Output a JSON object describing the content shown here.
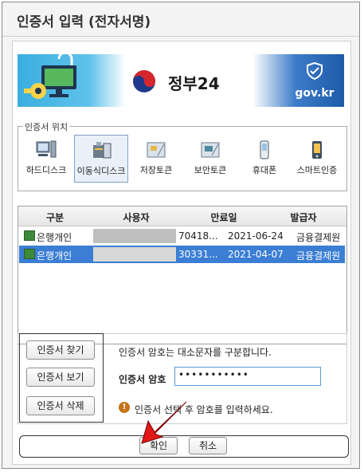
{
  "title": "인증서 입력 (전자서명)",
  "banner": {
    "logo_text": "정부24",
    "right_text": "gov.kr",
    "left_icon": "key-monitor-icon",
    "shield_icon": "shield-check-icon"
  },
  "location": {
    "label": "인증서 위치",
    "items": [
      {
        "label": "하드디스크",
        "icon": "computer-icon",
        "selected": false
      },
      {
        "label": "이동식디스크",
        "icon": "usb-drive-icon",
        "selected": true
      },
      {
        "label": "저장토큰",
        "icon": "storage-token-icon",
        "selected": false
      },
      {
        "label": "보안토큰",
        "icon": "security-token-icon",
        "selected": false
      },
      {
        "label": "휴대폰",
        "icon": "mobile-phone-icon",
        "selected": false
      },
      {
        "label": "스마트인증",
        "icon": "smart-cert-icon",
        "selected": false
      }
    ]
  },
  "table": {
    "headers": [
      "구분",
      "사용자",
      "만료일",
      "발급자"
    ],
    "rows": [
      {
        "type": "은행개인",
        "user": "70418...",
        "expiry": "2021-06-24",
        "issuer": "금융결제원",
        "selected": false
      },
      {
        "type": "은행개인",
        "user": "30331...",
        "expiry": "2021-04-07",
        "issuer": "금융결제원",
        "selected": true
      }
    ]
  },
  "buttons": {
    "find": "인증서 찾기",
    "view": "인증서 보기",
    "delete": "인증서 삭제",
    "ok": "확인",
    "cancel": "취소"
  },
  "password": {
    "note": "인증서 암호는 대소문자를 구분합니다.",
    "label": "인증서 암호",
    "value": "•••••••••••",
    "hint": "인증서 선택 후 암호를 입력하세요."
  },
  "colors": {
    "selected_row": "#3b7ed4",
    "warn": "#c5741b",
    "banner_blue": "#1d5aa8"
  }
}
